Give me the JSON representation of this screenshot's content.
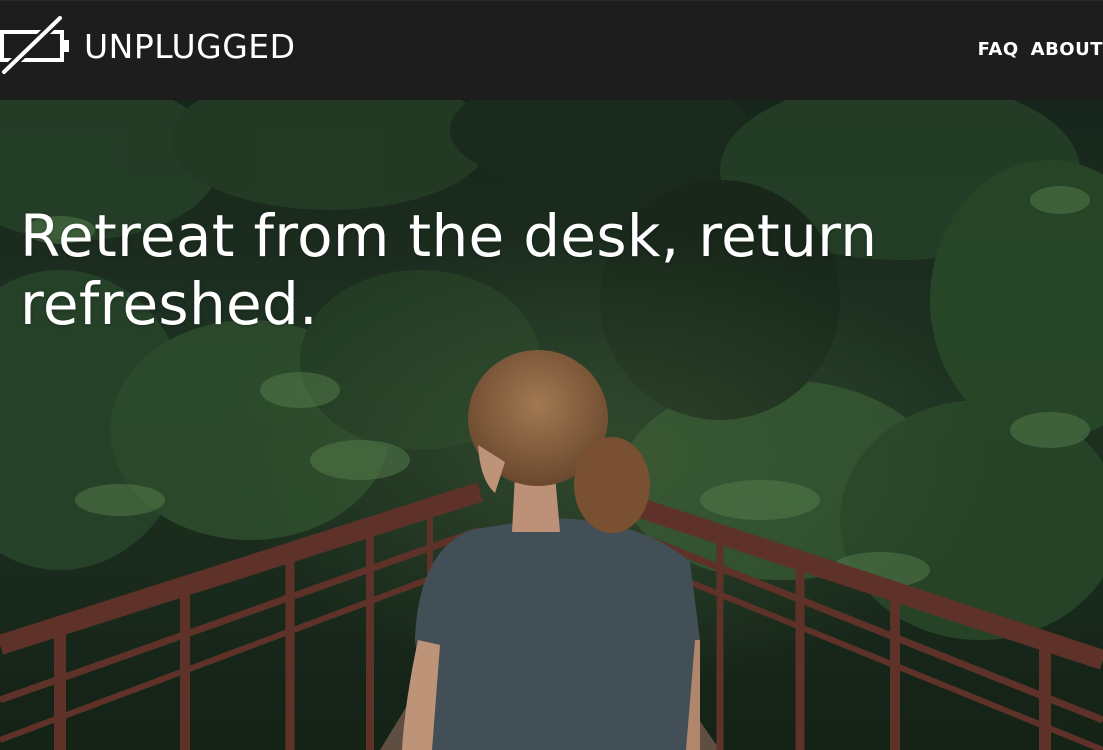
{
  "header": {
    "logo_text": "UNPLUGGED",
    "logo_icon": "battery-off-icon",
    "nav": [
      {
        "label": "FAQ"
      },
      {
        "label": "ABOUT"
      }
    ]
  },
  "hero": {
    "headline": "Retreat from the desk, return refreshed.",
    "image": "woman-on-forest-bridge-photo"
  },
  "colors": {
    "header_bg": "#1d1d1d",
    "text": "#ffffff",
    "forest_dark": "#1f3323",
    "railing": "#6b3a2e",
    "shirt": "#4d5a63"
  }
}
